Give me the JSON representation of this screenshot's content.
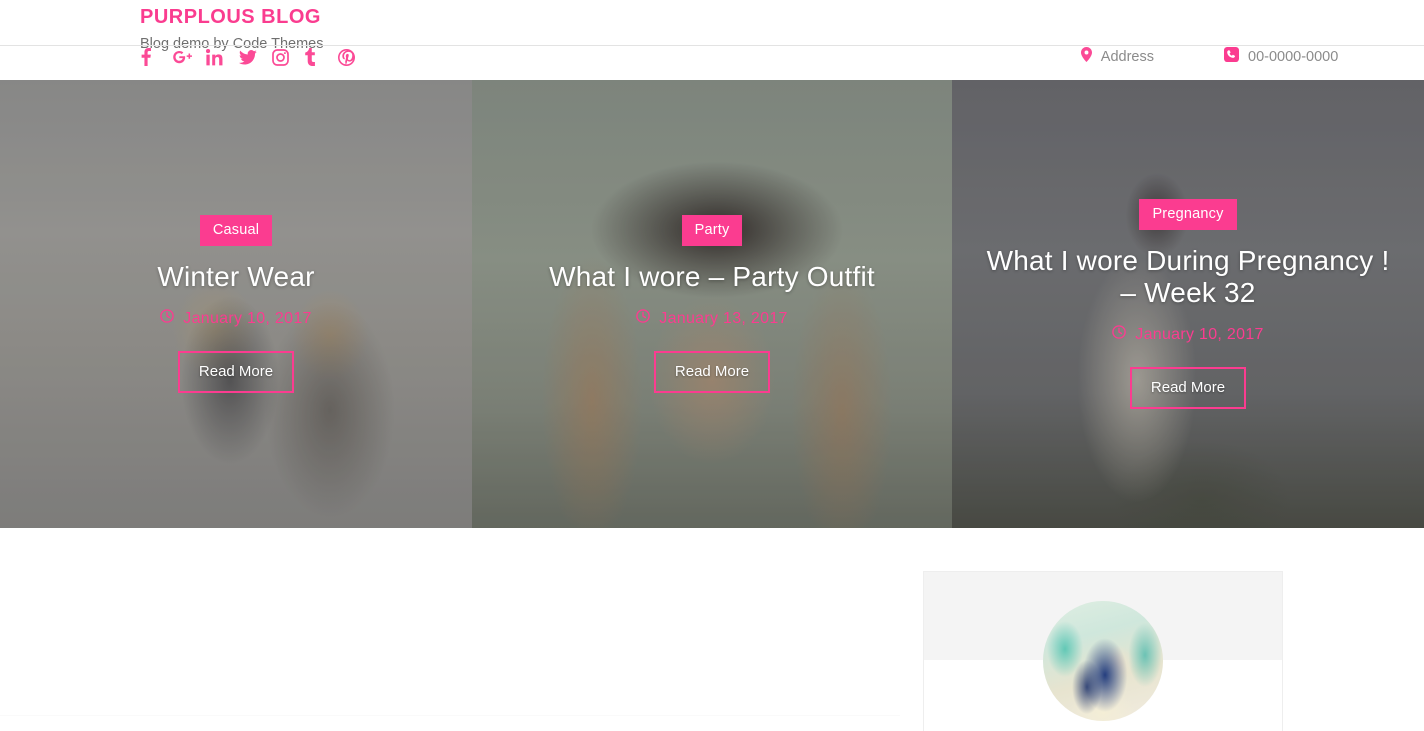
{
  "header": {
    "brand_title": "PURPLOUS BLOG",
    "tagline": "Blog demo by Code Themes",
    "social": [
      {
        "name": "facebook",
        "label": "f"
      },
      {
        "name": "google-plus",
        "label": "G+"
      },
      {
        "name": "linkedin",
        "label": "in"
      },
      {
        "name": "twitter",
        "label": ""
      },
      {
        "name": "instagram",
        "label": ""
      },
      {
        "name": "tumblr",
        "label": "t"
      },
      {
        "name": "pinterest",
        "label": ""
      }
    ],
    "address_label": "Address",
    "phone_number": "00-0000-0000"
  },
  "featured": [
    {
      "category": "Casual",
      "title": "Winter Wear",
      "date": "January 10, 2017",
      "read_more": "Read More"
    },
    {
      "category": "Party",
      "title": "What I wore – Party Outfit",
      "date": "January 13, 2017",
      "read_more": "Read More"
    },
    {
      "category": "Pregnancy",
      "title": "What I wore During Pregnancy ! – Week 32",
      "date": "January 10, 2017",
      "read_more": "Read More"
    }
  ],
  "sidebar": {
    "about_widget": {
      "avatar_alt": "author-portrait"
    }
  },
  "colors": {
    "accent_pink": "#fb3c90",
    "social_pink": "#fb4a96",
    "muted_text": "#8b8b8b",
    "tagline_text": "#6f6f6f",
    "widget_band": "#f4f4f4",
    "rule": "#e3e3e3"
  }
}
